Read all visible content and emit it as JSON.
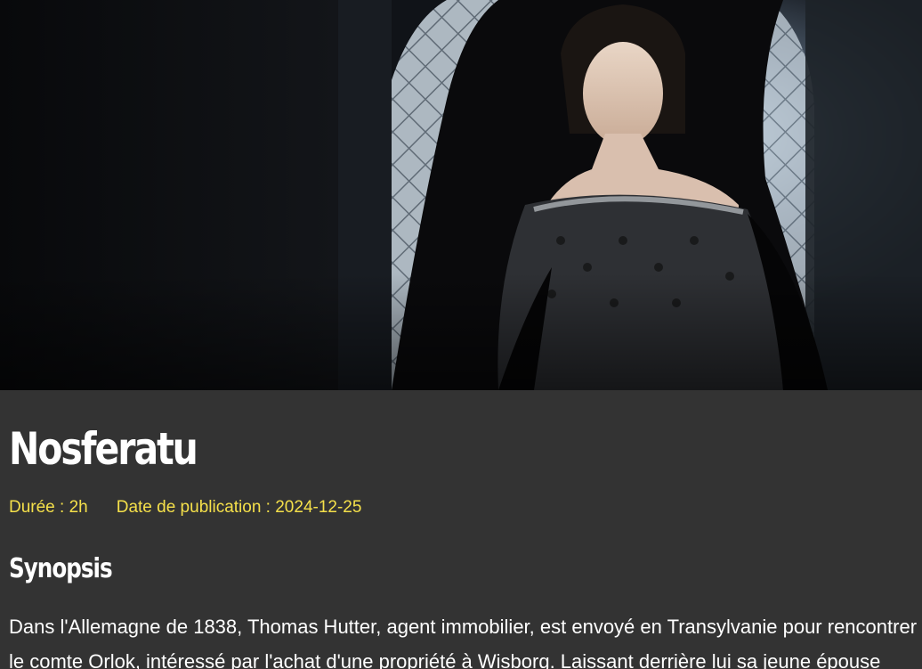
{
  "movie": {
    "title": "Nosferatu",
    "duration_label": "Durée : 2h",
    "release_label": "Date de publication : 2024-12-25"
  },
  "synopsis": {
    "heading": "Synopsis",
    "text": "Dans l'Allemagne de 1838, Thomas Hutter, agent immobilier, est envoyé en Transylvanie pour rencontrer le comte Orlok, intéressé par l'achat d'une propriété à Wisborg. Laissant derrière lui sa jeune épouse"
  },
  "hero_image": {
    "alt": "Nosferatu poster"
  },
  "colors": {
    "page_background": "#333333",
    "accent": "#f5e04a",
    "text": "#ffffff"
  }
}
